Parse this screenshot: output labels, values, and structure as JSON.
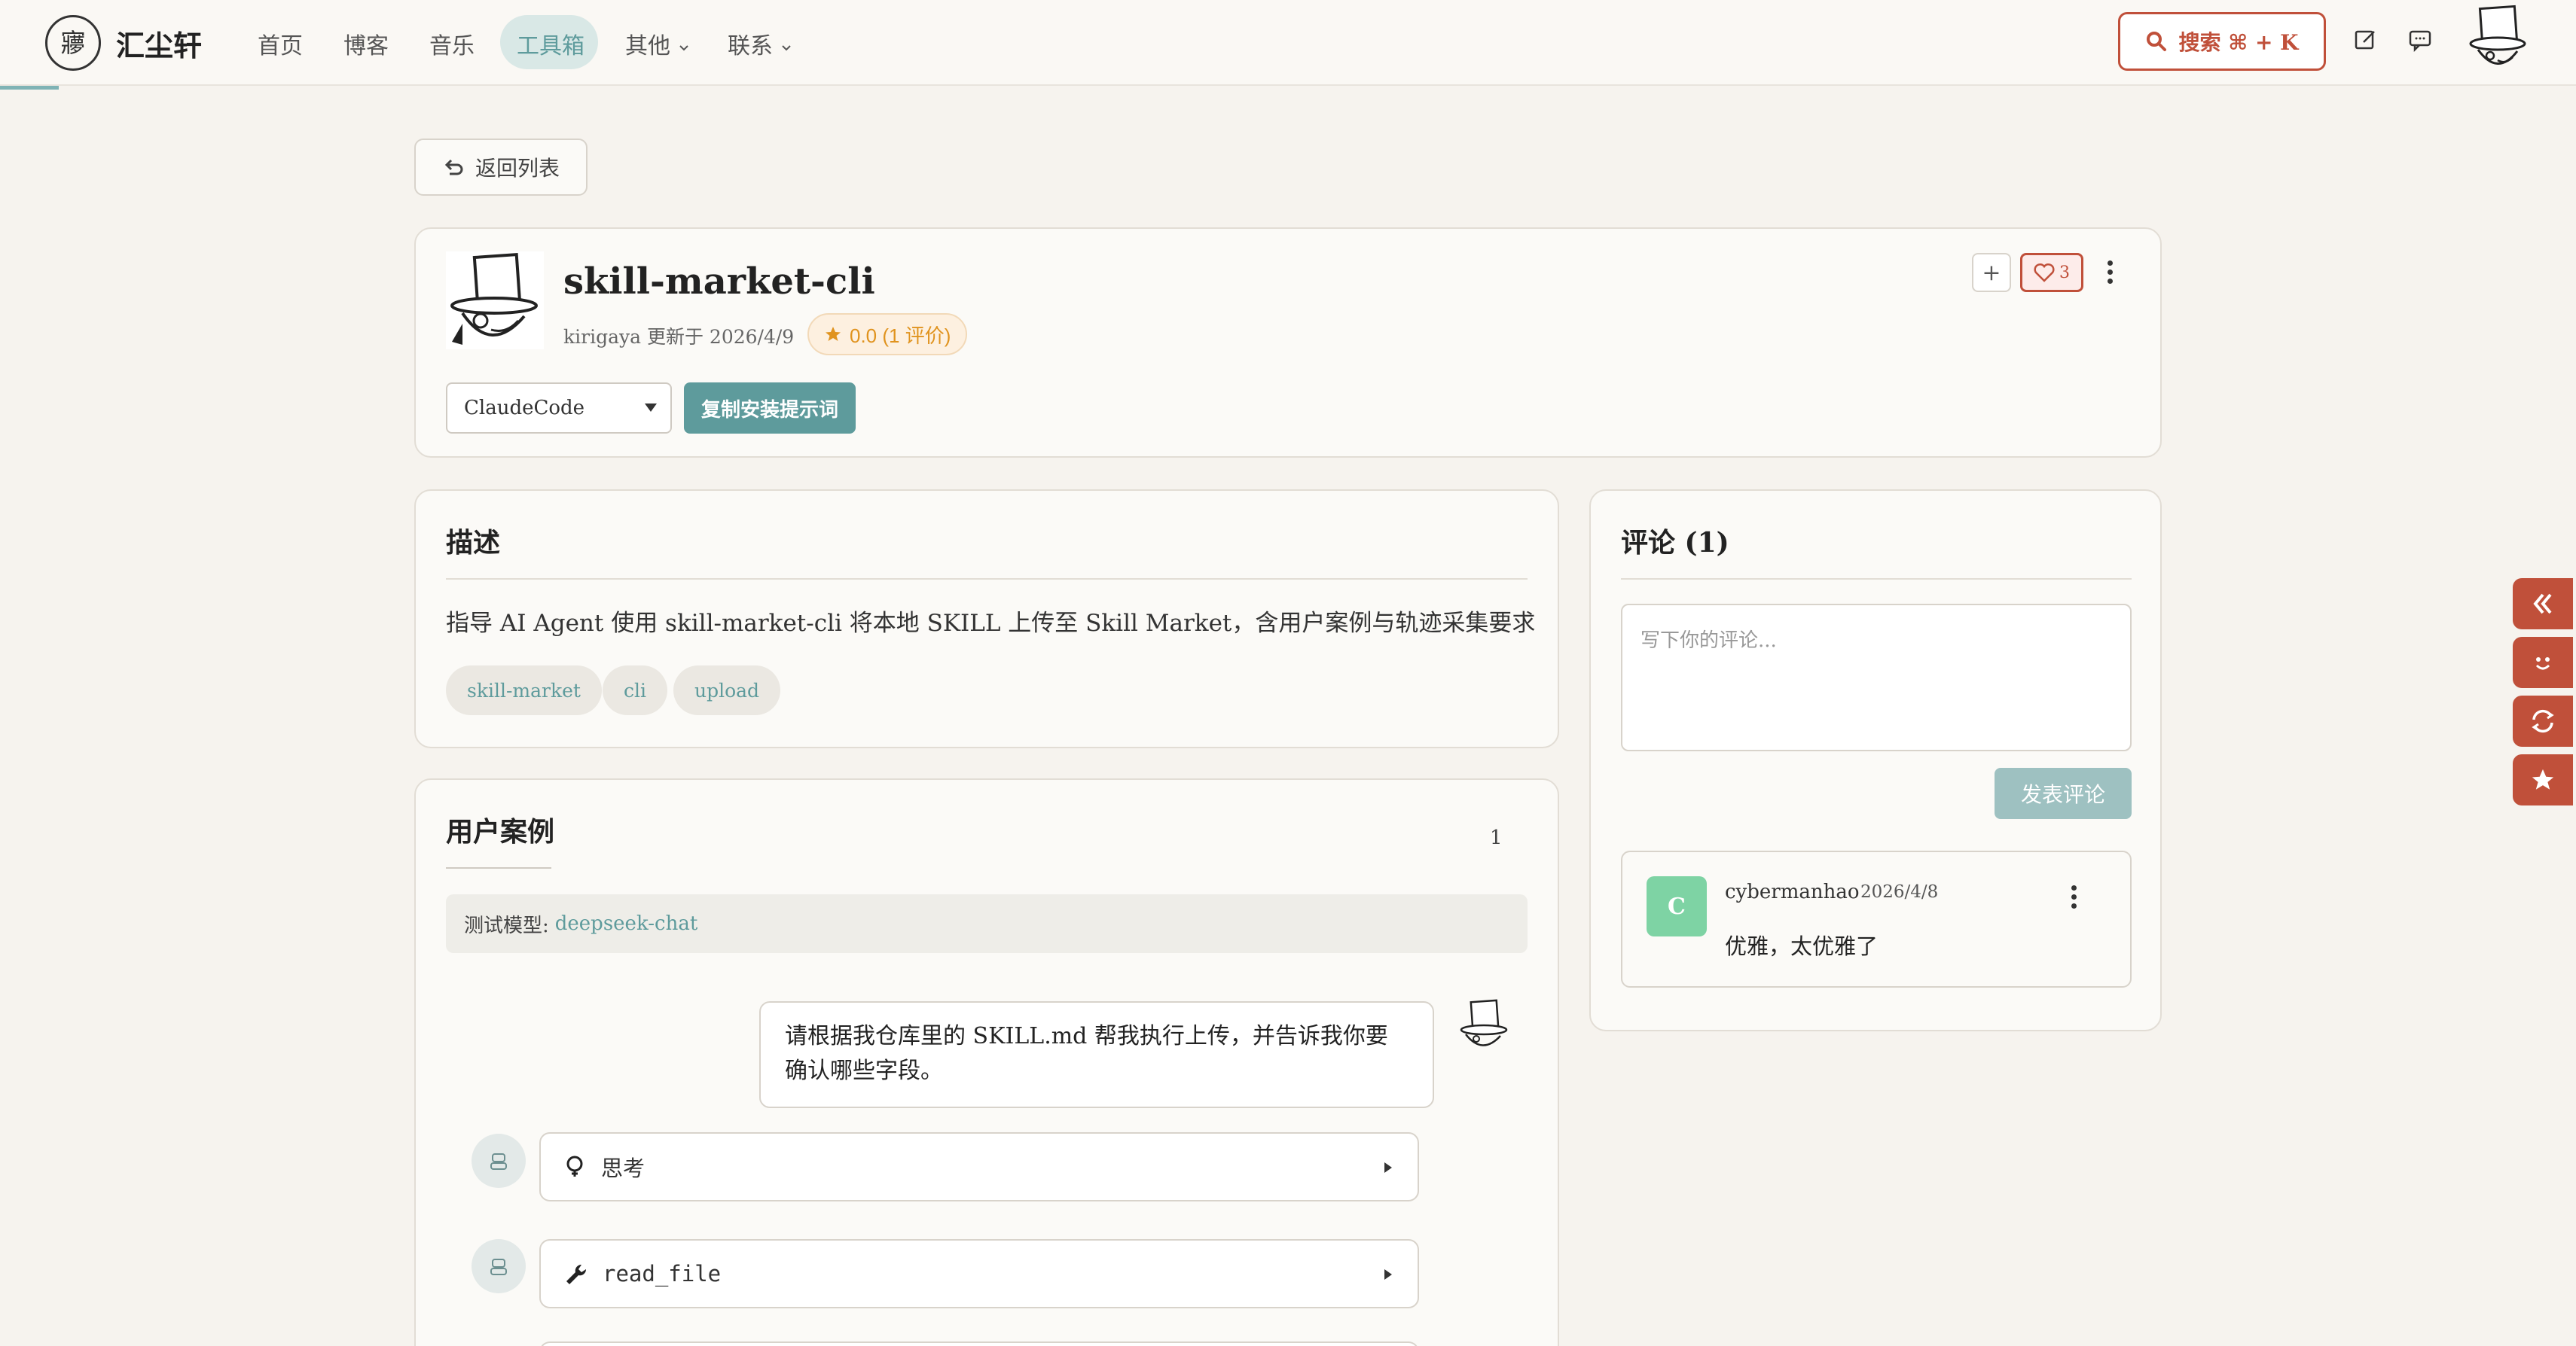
{
  "header": {
    "site_name": "汇尘轩",
    "nav": [
      "首页",
      "博客",
      "音乐",
      "工具箱",
      "其他",
      "联系"
    ],
    "active_nav": "工具箱",
    "search_label": "搜索 ⌘ + K"
  },
  "back_label": "返回列表",
  "skill": {
    "title": "skill-market-cli",
    "author": "kirigaya",
    "updated": "更新于 2026/4/9",
    "rating": "0.0 (1 评价)",
    "platform": "ClaudeCode",
    "copy_label": "复制安装提示词",
    "likes": "3",
    "plus": "+"
  },
  "description": {
    "title": "描述",
    "text": "指导 AI Agent 使用 skill-market-cli 将本地 SKILL 上传至 Skill Market，含用户案例与轨迹采集要求",
    "tags": [
      "skill-market",
      "cli",
      "upload"
    ]
  },
  "cases": {
    "title": "用户案例",
    "count": "1",
    "model_label": "测试模型:",
    "model": "deepseek-chat",
    "user_message": "请根据我仓库里的 SKILL.md 帮我执行上传，并告诉我你要确认哪些字段。",
    "steps": [
      {
        "icon": "lightbulb-icon",
        "label": "思考"
      },
      {
        "icon": "wrench-icon",
        "label": "read_file"
      }
    ]
  },
  "comments": {
    "title": "评论 (1)",
    "placeholder": "写下你的评论...",
    "post_label": "发表评论",
    "items": [
      {
        "initial": "C",
        "user": "cybermanhao",
        "date": "2026/4/8",
        "text": "优雅，太优雅了"
      }
    ]
  },
  "colors": {
    "accent": "#5e9b9c",
    "brand_red": "#c0503a",
    "rating": "#e0931e"
  }
}
